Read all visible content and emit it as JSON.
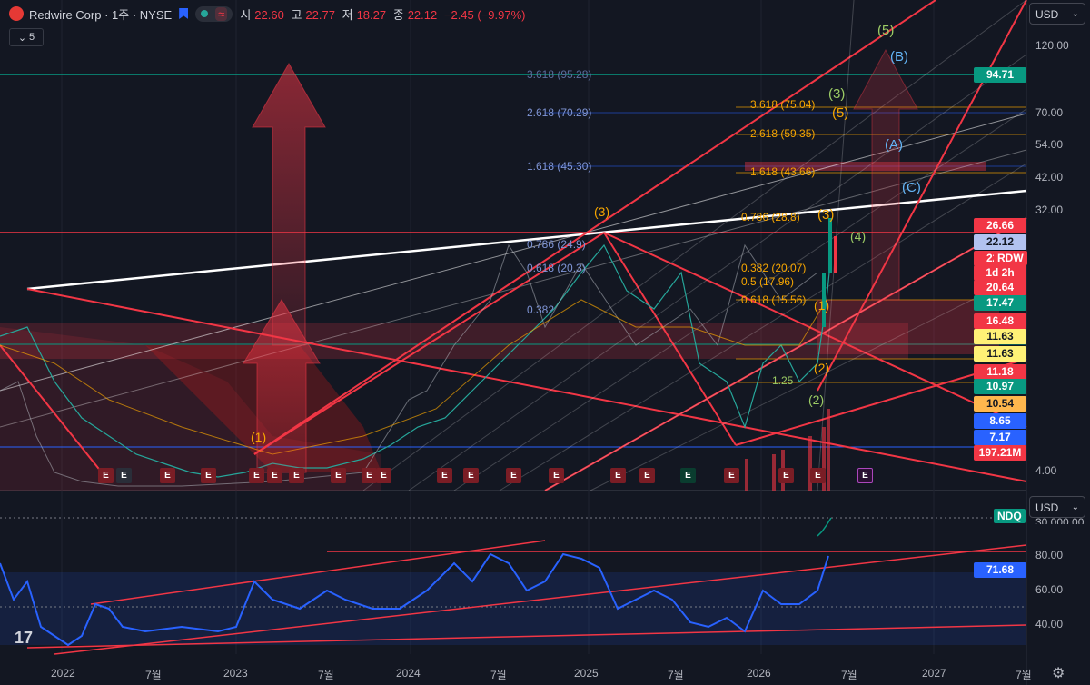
{
  "legend": {
    "symbol": "Redwire Corp · 1주 · NYSE",
    "open_label": "시",
    "open": "22.60",
    "high_label": "고",
    "high": "22.77",
    "low_label": "저",
    "low": "18.27",
    "close_label": "종",
    "close": "22.12",
    "change": "−2.45 (−9.97%)",
    "subpane_toggle": "5"
  },
  "currency_main": "USD",
  "currency_sub": "USD",
  "price_axis": {
    "ticks": [
      "120.00",
      "70.00",
      "54.00",
      "42.00",
      "32.00",
      "4.00"
    ],
    "badges": [
      {
        "text": "94.71",
        "bg": "#089981",
        "fg": "#ffffff"
      },
      {
        "text": "26.66",
        "bg": "#f23645",
        "fg": "#ffffff"
      },
      {
        "text": "22.12",
        "bg": "#b2c2f0",
        "fg": "#131722"
      },
      {
        "text": "22.12",
        "bg": "#f23645",
        "fg": "#ffffff"
      },
      {
        "text": "1d 2h",
        "bg": "#f23645",
        "fg": "#ffffff"
      },
      {
        "text": "20.64",
        "bg": "#f23645",
        "fg": "#ffffff"
      },
      {
        "text": "17.47",
        "bg": "#089981",
        "fg": "#ffffff"
      },
      {
        "text": "16.48",
        "bg": "#f23645",
        "fg": "#ffffff"
      },
      {
        "text": "11.63",
        "bg": "#fff176",
        "fg": "#131722"
      },
      {
        "text": "11.63",
        "bg": "#fff176",
        "fg": "#131722"
      },
      {
        "text": "11.18",
        "bg": "#f23645",
        "fg": "#ffffff"
      },
      {
        "text": "10.97",
        "bg": "#089981",
        "fg": "#ffffff"
      },
      {
        "text": "10.54",
        "bg": "#ffb74d",
        "fg": "#131722"
      },
      {
        "text": "8.65",
        "bg": "#2962ff",
        "fg": "#ffffff"
      },
      {
        "text": "7.17",
        "bg": "#2962ff",
        "fg": "#ffffff"
      },
      {
        "text": "197.21M",
        "bg": "#f23645",
        "fg": "#ffffff"
      }
    ],
    "rdw_tag": "RDW"
  },
  "sub_axis": {
    "ticks": [
      "80.00",
      "60.00",
      "40.00"
    ],
    "rsi_value": "71.68",
    "cut_value": "30,000.00",
    "ndq_tag": "NDQ"
  },
  "fib_labels": [
    "3.618 (95.28)",
    "2.618 (70.29)",
    "1.618 (45.30)",
    "3.618 (75.04)",
    "2.618 (59.35)",
    "1.618 (43.66)",
    "0.786 (24.9)",
    "0.618 (20.3)",
    "0.382",
    "0.618 (15.56)",
    "0.5 (17.96)",
    "0.382 (20.07)",
    "0.786 (28.8)"
  ],
  "waves": [
    "(1)",
    "(3)",
    "(5)",
    "(3)",
    "(5)",
    "(B)",
    "(A)",
    "(C)",
    "(3)",
    "(4)",
    "(1)",
    "(2)",
    "(2)",
    "(1)",
    "1.25"
  ],
  "earnings_marker": "E",
  "time_axis": [
    "2022",
    "7월",
    "2023",
    "7월",
    "2024",
    "7월",
    "2025",
    "7월",
    "2026",
    "7월",
    "2027",
    "7월"
  ],
  "colors": {
    "bg": "#131722",
    "red": "#f23645",
    "green": "#089981",
    "blue": "#2962ff",
    "orange": "#f7a600",
    "rsi": "#2962ff"
  },
  "icons": [
    "logo-icon",
    "flag-icon",
    "status-dot-icon",
    "wave-icon",
    "tradingview-logo-icon",
    "gear-icon",
    "chevron-down-icon"
  ]
}
